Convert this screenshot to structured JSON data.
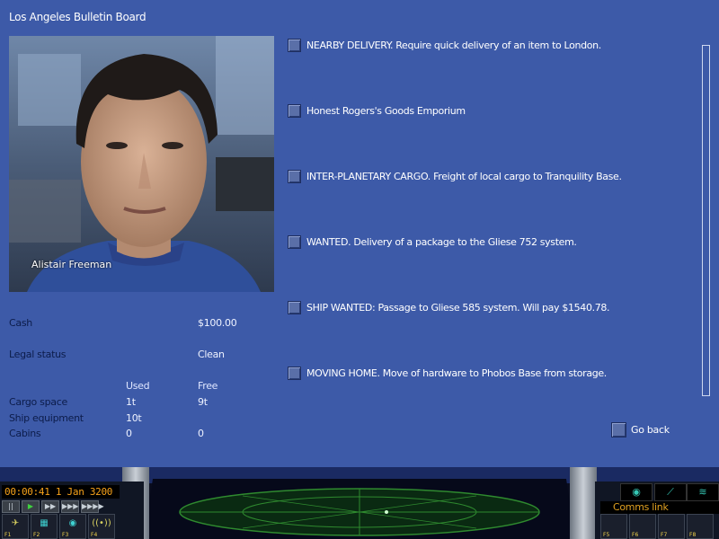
{
  "window": {
    "title": "Los Angeles Bulletin Board"
  },
  "portrait": {
    "name": "Alistair Freeman"
  },
  "stats": {
    "cash_label": "Cash",
    "cash_value": "$100.00",
    "legal_label": "Legal status",
    "legal_value": "Clean",
    "used_header": "Used",
    "free_header": "Free",
    "rows": [
      {
        "label": "Cargo space",
        "used": "1t",
        "free": "9t"
      },
      {
        "label": "Ship equipment",
        "used": "10t",
        "free": ""
      },
      {
        "label": "Cabins",
        "used": "0",
        "free": "0"
      }
    ]
  },
  "board": {
    "items": [
      {
        "text": "NEARBY DELIVERY. Require quick delivery of an item to London."
      },
      {
        "text": "Honest Rogers's Goods Emporium"
      },
      {
        "text": "INTER-PLANETARY CARGO. Freight of local cargo to Tranquility Base."
      },
      {
        "text": "WANTED. Delivery of a package to the Gliese 752 system."
      },
      {
        "text": "SHIP WANTED: Passage to Gliese 585 system. Will pay $1540.78."
      },
      {
        "text": "MOVING HOME. Move of hardware to Phobos Base from storage."
      }
    ],
    "go_back": "Go back"
  },
  "console": {
    "clock": "00:00:41 1 Jan 3200",
    "time_controls": [
      "||",
      "▶",
      "▶▶",
      "▶▶▶",
      "▶▶▶▶"
    ],
    "left_fkeys": [
      "F1",
      "F2",
      "F3",
      "F4"
    ],
    "right_fkeys": [
      "F5",
      "F6",
      "F7",
      "F8"
    ],
    "comms_link": "Comms link",
    "colors": {
      "clock": "#f7a21a",
      "scanner": "#2f8a2f",
      "accent": "#3d5aa8"
    }
  }
}
